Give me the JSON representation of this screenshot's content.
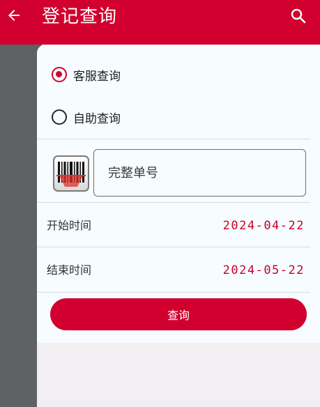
{
  "appbar": {
    "title": "登记查询",
    "back_icon": "arrow-left-icon",
    "search_icon": "search-icon",
    "color": "#d2002e"
  },
  "query_mode": {
    "options": [
      {
        "label": "客服查询",
        "selected": true
      },
      {
        "label": "自助查询",
        "selected": false
      }
    ]
  },
  "order": {
    "scan_icon": "barcode-scan-icon",
    "placeholder": "完整单号",
    "value": ""
  },
  "start_time": {
    "label": "开始时间",
    "value": "2024-04-22"
  },
  "end_time": {
    "label": "结束时间",
    "value": "2024-05-22"
  },
  "submit": {
    "label": "查询"
  }
}
